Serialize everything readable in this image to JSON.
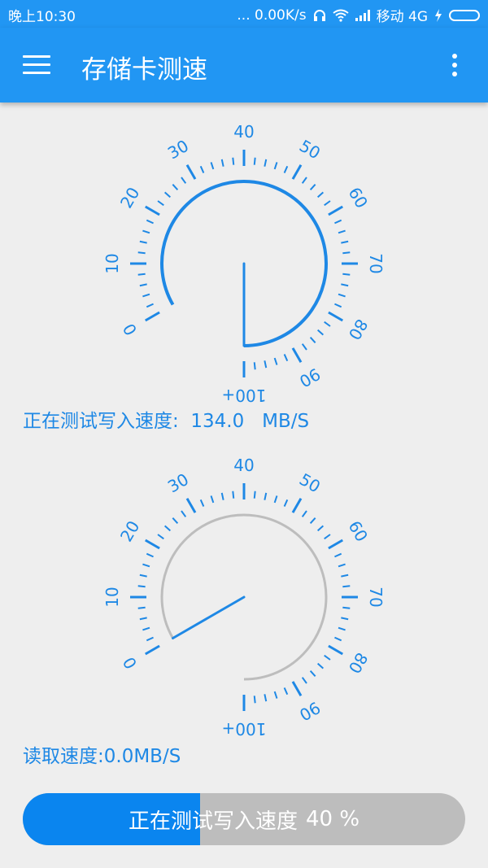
{
  "status_bar": {
    "time": "晚上10:30",
    "net_speed": "... 0.00K/s",
    "carrier": "移动 4G",
    "icons": [
      "headset-icon",
      "wifi-icon",
      "signal-icon",
      "charging-icon",
      "battery-icon"
    ]
  },
  "app_bar": {
    "title": "存储卡测速",
    "menu_icon": "hamburger-menu-icon",
    "more_icon": "more-vert-icon"
  },
  "write_gauge": {
    "scale_labels": [
      "0",
      "10",
      "20",
      "30",
      "40",
      "50",
      "60",
      "70",
      "80",
      "90",
      "100+"
    ],
    "min": 0,
    "max": 100,
    "value": 134.0,
    "arc_color": "#1e88e5",
    "needle_color": "#1e88e5"
  },
  "write_speed": {
    "label": "正在测试写入速度:",
    "value": "134.0",
    "unit": "MB/S"
  },
  "read_gauge": {
    "scale_labels": [
      "0",
      "10",
      "20",
      "30",
      "40",
      "50",
      "60",
      "70",
      "80",
      "90",
      "100+"
    ],
    "min": 0,
    "max": 100,
    "value": 0.0,
    "arc_color": "#bdbdbd",
    "needle_color": "#1e88e5"
  },
  "read_speed": {
    "text": "读取速度:0.0MB/S"
  },
  "progress": {
    "label": "正在测试写入速度",
    "percent_text": "40 %",
    "value": 0.4,
    "fill_color": "#0a85ef",
    "track_color": "#bdbdbd"
  },
  "colors": {
    "primary": "#2196f3",
    "accent": "#1e88e5",
    "background": "#eeeeee"
  }
}
